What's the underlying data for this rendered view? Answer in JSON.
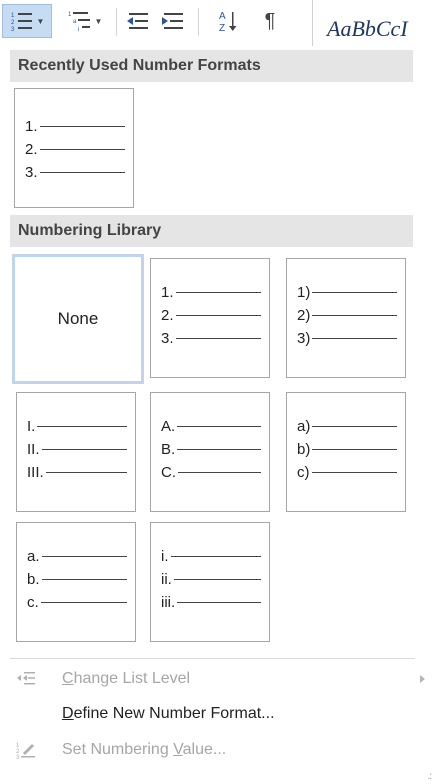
{
  "ribbon": {
    "style_preview": "AaBbCcI"
  },
  "recent": {
    "header": "Recently Used Number Formats",
    "tiles": [
      {
        "lines": [
          "1.",
          "2.",
          "3."
        ]
      }
    ]
  },
  "library": {
    "header": "Numbering Library",
    "tiles": [
      {
        "none_label": "None",
        "lines": []
      },
      {
        "lines": [
          "1.",
          "2.",
          "3."
        ]
      },
      {
        "lines": [
          "1)",
          "2)",
          "3)"
        ]
      },
      {
        "lines": [
          "I.",
          "II.",
          "III."
        ]
      },
      {
        "lines": [
          "A.",
          "B.",
          "C."
        ]
      },
      {
        "lines": [
          "a)",
          "b)",
          "c)"
        ]
      },
      {
        "lines": [
          "a.",
          "b.",
          "c."
        ]
      },
      {
        "lines": [
          "i.",
          "ii.",
          "iii."
        ]
      }
    ]
  },
  "menu": {
    "change_level": {
      "pre": "",
      "key": "C",
      "post": "hange List Level"
    },
    "define_format": {
      "pre": "",
      "key": "D",
      "post": "efine New Number Format..."
    },
    "set_value": {
      "pre": "Set Numbering ",
      "key": "V",
      "post": "alue..."
    }
  },
  "icons": {
    "numbering": "numbered-list-icon",
    "multilevel": "multilevel-list-icon",
    "decrease_indent": "decrease-indent-icon",
    "increase_indent": "increase-indent-icon",
    "sort": "sort-az-icon",
    "show_marks": "pilcrow-icon",
    "change_level": "change-list-level-icon",
    "set_value": "set-numbering-value-icon"
  },
  "colors": {
    "ribbon_active": "#c5dcf2",
    "header_bg": "#e5e5e5",
    "selected_border": "#bfd5ec",
    "disabled_text": "#a6a6a6"
  }
}
